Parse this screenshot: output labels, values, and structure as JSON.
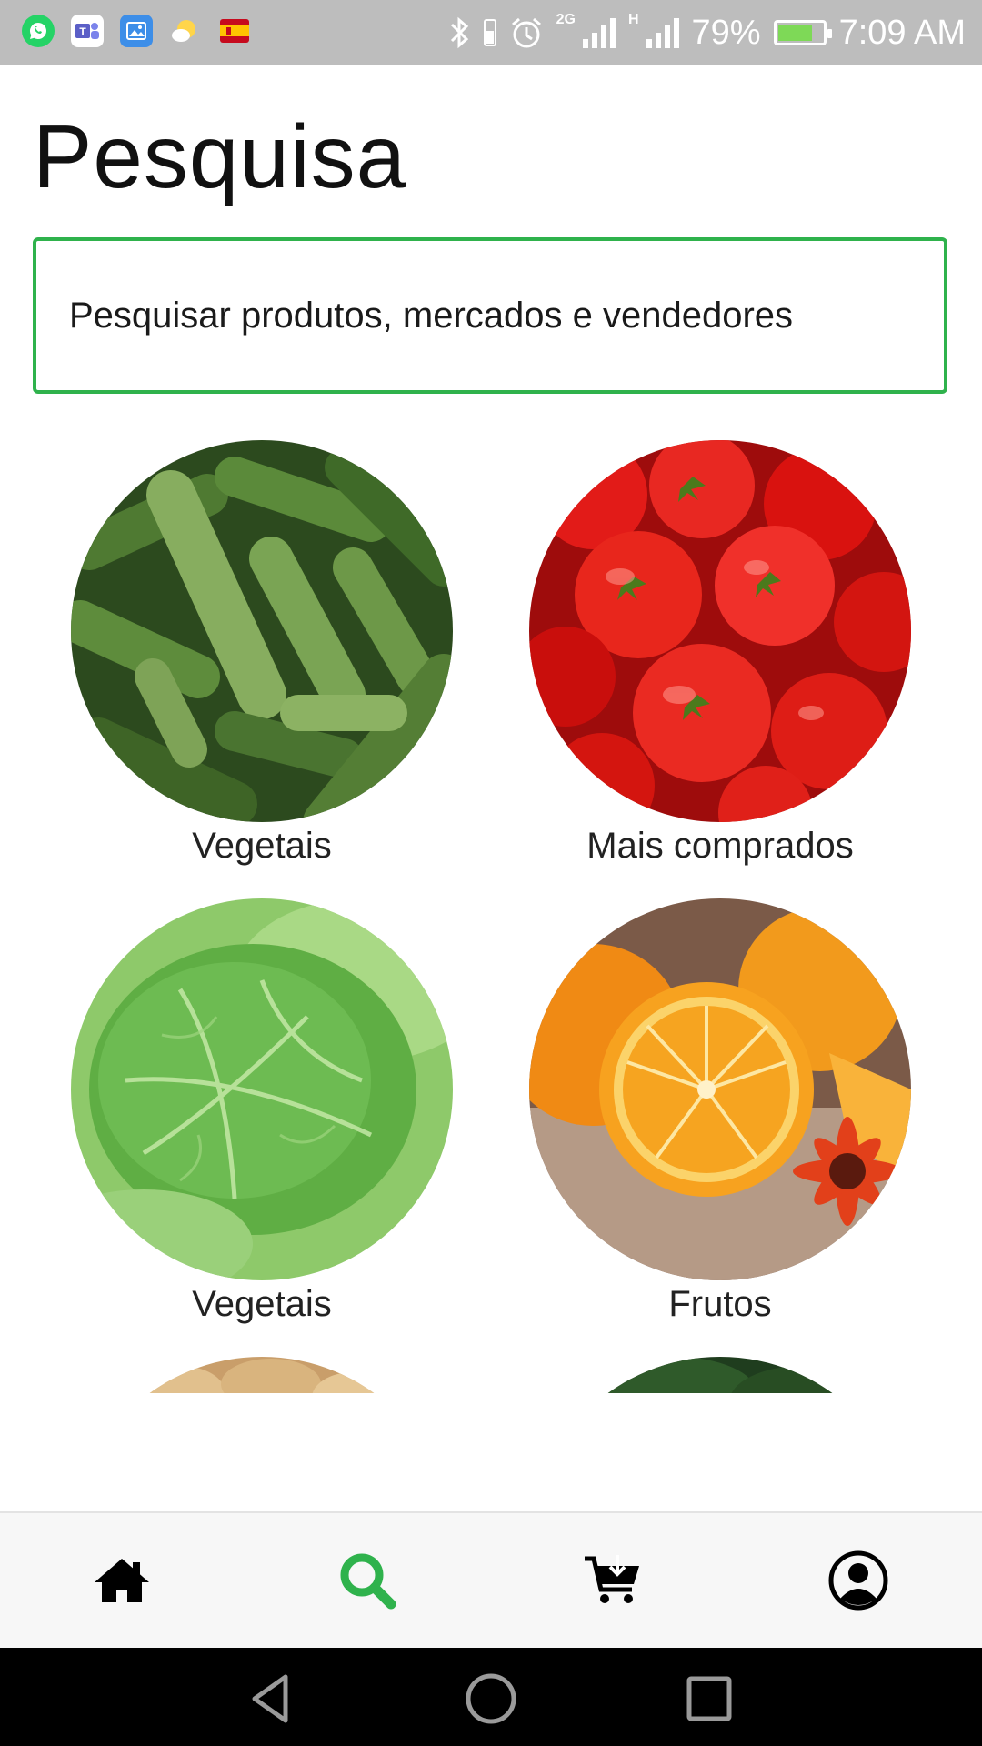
{
  "status_bar": {
    "notification_icons": [
      "whatsapp-icon",
      "teams-icon",
      "gallery-icon",
      "weather-icon",
      "spain-flag-icon"
    ],
    "network_1": "2G",
    "network_2": "H",
    "battery": "79%",
    "battery_level": 0.79,
    "time": "7:09 AM"
  },
  "header": {
    "title": "Pesquisa"
  },
  "search": {
    "placeholder": "Pesquisar produtos, mercados e vendedores"
  },
  "categories": [
    {
      "label": "Vegetais",
      "image": "cucumbers"
    },
    {
      "label": "Mais comprados",
      "image": "tomatoes"
    },
    {
      "label": "Vegetais",
      "image": "cabbage"
    },
    {
      "label": "Frutos",
      "image": "oranges"
    },
    {
      "label": "",
      "image": "potatoes"
    },
    {
      "label": "",
      "image": "greens"
    }
  ],
  "bottom_nav": {
    "items": [
      {
        "icon": "home-icon",
        "active": false
      },
      {
        "icon": "search-icon",
        "active": true
      },
      {
        "icon": "cart-icon",
        "active": false
      },
      {
        "icon": "profile-icon",
        "active": false
      }
    ],
    "active_color": "#2fb24c"
  },
  "colors": {
    "accent": "#2fb24c",
    "status_bar": "#bdbdbd"
  }
}
